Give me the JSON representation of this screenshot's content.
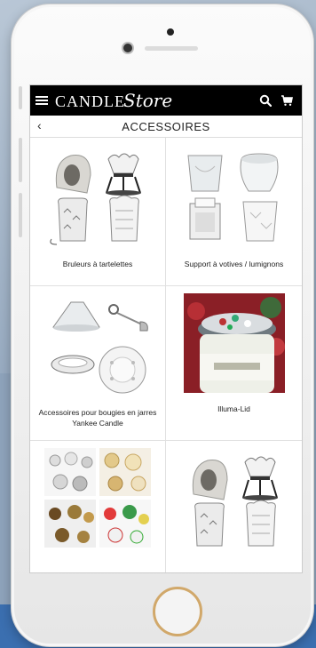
{
  "header": {
    "menu_icon": "hamburger-icon",
    "logo_main": "CANDLE",
    "logo_script": "Store",
    "search_icon": "search-icon",
    "cart_icon": "cart-icon"
  },
  "subheader": {
    "back_icon": "chevron-left-icon",
    "back_glyph": "‹",
    "title": "ACCESSOIRES"
  },
  "categories": [
    {
      "label": "Bruleurs à tartelettes"
    },
    {
      "label": "Support à votives / lumignons"
    },
    {
      "label": "Accessoires pour bougies en jarres Yankee Candle"
    },
    {
      "label": "Illuma-Lid"
    },
    {
      "label": ""
    },
    {
      "label": ""
    }
  ],
  "colors": {
    "header_bg": "#000000",
    "home_ring": "#d1a86a"
  }
}
